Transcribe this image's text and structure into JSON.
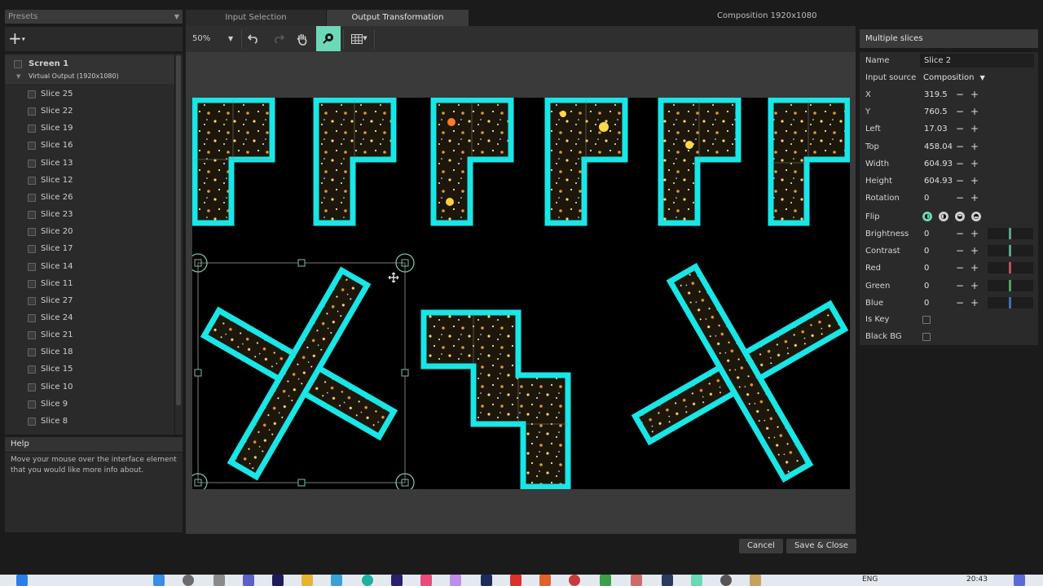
{
  "presets": {
    "label": "Presets"
  },
  "toolbar_left": {
    "add_label": "+",
    "add_caret": "▾"
  },
  "tree": {
    "screen_label": "Screen 1",
    "output_label": "Virtual Output (1920x1080)",
    "slices": [
      "Slice 25",
      "Slice 22",
      "Slice 19",
      "Slice 16",
      "Slice 13",
      "Slice 12",
      "Slice 26",
      "Slice 23",
      "Slice 20",
      "Slice 17",
      "Slice 14",
      "Slice 11",
      "Slice 27",
      "Slice 24",
      "Slice 21",
      "Slice 18",
      "Slice 15",
      "Slice 10",
      "Slice 9",
      "Slice 8"
    ]
  },
  "help": {
    "title": "Help",
    "text": "Move your mouse over the interface element that you would like more info about."
  },
  "tabs": {
    "input": "Input Selection",
    "output": "Output Transformation"
  },
  "composition_label": "Composition 1920x1080",
  "toolbar": {
    "zoom": "50%",
    "zoom_caret": "▼"
  },
  "right_panel": {
    "title": "Multiple slices",
    "name_label": "Name",
    "name_value": "Slice 2",
    "input_source_label": "Input source",
    "input_source_value": "Composition",
    "x_label": "X",
    "x_value": "319.5",
    "y_label": "Y",
    "y_value": "760.5",
    "left_label": "Left",
    "left_value": "17.03",
    "top_label": "Top",
    "top_value": "458.04",
    "width_label": "Width",
    "width_value": "604.93",
    "height_label": "Height",
    "height_value": "604.93",
    "rotation_label": "Rotation",
    "rotation_value": "0",
    "flip_label": "Flip",
    "brightness_label": "Brightness",
    "brightness_value": "0",
    "contrast_label": "Contrast",
    "contrast_value": "0",
    "red_label": "Red",
    "red_value": "0",
    "green_label": "Green",
    "green_value": "0",
    "blue_label": "Blue",
    "blue_value": "0",
    "iskey_label": "Is Key",
    "blackbg_label": "Black BG",
    "minus": "−",
    "plus": "+"
  },
  "buttons": {
    "cancel": "Cancel",
    "save_close": "Save & Close"
  },
  "taskbar": {
    "lang": "ENG",
    "time": "20:43"
  },
  "colors": {
    "slice_outline": "#19e6e6",
    "accent_active": "#6bd9b8",
    "handle": "#7fbfa0"
  }
}
